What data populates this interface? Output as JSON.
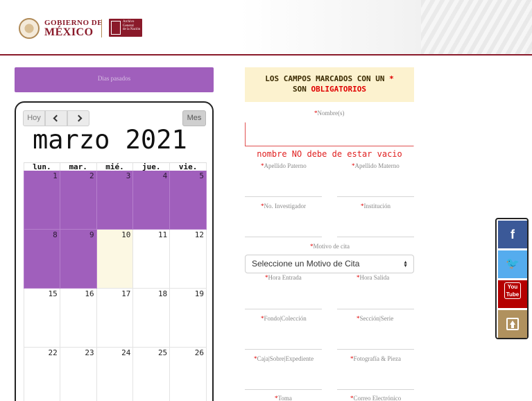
{
  "header": {
    "gobierno_line1": "GOBIERNO DE",
    "gobierno_line2": "MÉXICO",
    "archivo_text": "Archivo\nGeneral\nde la Nación",
    "brand_color": "#8a1a2a"
  },
  "calendar": {
    "past_days_banner": "Dias pasados",
    "today_button": "Hoy",
    "prev_icon": "chevron-left-icon",
    "next_icon": "chevron-right-icon",
    "month_button": "Mes",
    "title": "marzo 2021",
    "weekdays": [
      "lun.",
      "mar.",
      "mié.",
      "jue.",
      "vie."
    ],
    "weeks": [
      [
        "1",
        "2",
        "3",
        "4",
        "5"
      ],
      [
        "8",
        "9",
        "10",
        "11",
        "12"
      ],
      [
        "15",
        "16",
        "17",
        "18",
        "19"
      ],
      [
        "22",
        "23",
        "24",
        "25",
        "26"
      ]
    ],
    "past_color": "#a05fbc",
    "today_color": "#fcf8e3"
  },
  "form": {
    "notice_line1": "LOS CAMPOS MARCADOS CON UN",
    "notice_asterisk": "*",
    "notice_line2_prefix": "SON",
    "notice_obligatorios": "OBLIGATORIOS",
    "asterisk": "*",
    "nombre_label": "Nombre(s)",
    "nombre_error": "nombre NO debe de estar vacio",
    "apellido_paterno_label": "Apellido Paterno",
    "apellido_materno_label": "Apellido Materno",
    "no_investigador_label": "No. Investigador",
    "institucion_label": "Institución",
    "motivo_label": "Motivo de cita",
    "motivo_selected": "Seleccione un Motivo de Cita",
    "hora_entrada_label": "Hora Entrada",
    "hora_salida_label": "Hora Salida",
    "fondo_label": "Fondo|Colección",
    "seccion_label": "Sección|Serie",
    "caja_label": "Caja|Sobre|Expediente",
    "fotografia_label": "Fotografía & Pieza",
    "toma_label": "Toma",
    "correo_label": "Correo Electrónico"
  },
  "social": {
    "facebook_icon": "f",
    "twitter_icon": "🐦",
    "youtube_icon": "You\nTube",
    "facebook_color": "#3b5998",
    "twitter_color": "#55acee",
    "youtube_color": "#b50000",
    "top_color": "#b0915e"
  }
}
